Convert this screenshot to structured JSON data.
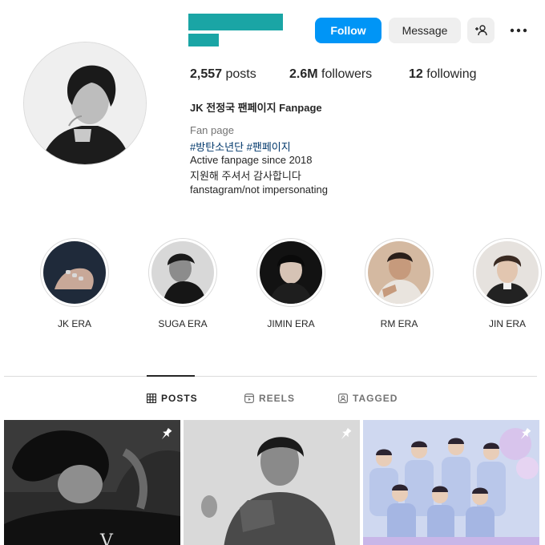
{
  "profile": {
    "full_name": "JK 전정국 팬페이지 Fanpage",
    "category": "Fan page",
    "bio_tags": "#방탄소년단 #팬페이지",
    "bio_lines": [
      "Active fanpage since 2018",
      "지원해 주셔서 감사합니다",
      "fanstagram/not impersonating"
    ]
  },
  "buttons": {
    "follow": "Follow",
    "message": "Message",
    "add_user_icon": "person-plus-icon",
    "more_icon": "more-options-icon"
  },
  "stats": {
    "posts_count": "2,557",
    "posts_label": "posts",
    "followers_count": "2.6M",
    "followers_label": "followers",
    "following_count": "12",
    "following_label": "following"
  },
  "highlights": [
    {
      "label": "JK ERA"
    },
    {
      "label": "SUGA ERA"
    },
    {
      "label": "JIMIN ERA"
    },
    {
      "label": "RM ERA"
    },
    {
      "label": "JIN ERA"
    }
  ],
  "tabs": [
    {
      "label": "POSTS",
      "icon": "grid-icon",
      "active": true
    },
    {
      "label": "REELS",
      "icon": "reels-icon",
      "active": false
    },
    {
      "label": "TAGGED",
      "icon": "tagged-icon",
      "active": false
    }
  ],
  "posts": [
    {
      "pinned": true
    },
    {
      "pinned": true
    },
    {
      "pinned": true
    }
  ],
  "colors": {
    "accent": "#0095f6",
    "redaction": "#1aa5a5",
    "link": "#00376b",
    "muted": "#737373"
  }
}
